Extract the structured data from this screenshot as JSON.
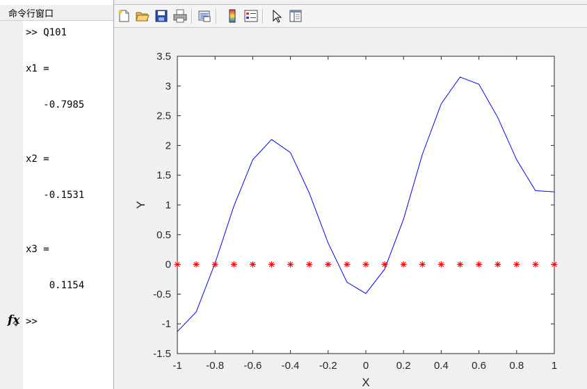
{
  "command_window": {
    "title": "命令行窗口",
    "lines": [
      {
        "text": ">> Q101"
      },
      {
        "text": "x1 ="
      },
      {
        "text": "   -0.7985"
      },
      {
        "text": "x2 ="
      },
      {
        "text": "   -0.1531"
      },
      {
        "text": "x3 ="
      },
      {
        "text": "    0.1154"
      }
    ],
    "prompt": ">>",
    "fx_label": "fx"
  },
  "toolbar": {
    "icons": [
      "new-figure-icon",
      "open-file-icon",
      "save-icon",
      "print-icon",
      "link-plot-icon",
      "insert-colorbar-icon",
      "insert-legend-icon",
      "edit-plot-arrow-icon",
      "property-inspector-icon"
    ]
  },
  "chart_data": {
    "type": "line",
    "title": "",
    "xlabel": "X",
    "ylabel": "Y",
    "xlim": [
      -1,
      1
    ],
    "ylim": [
      -1.5,
      3.5
    ],
    "xticks": [
      "-1",
      "-0.8",
      "-0.6",
      "-0.4",
      "-0.2",
      "0",
      "0.2",
      "0.4",
      "0.6",
      "0.8",
      "1"
    ],
    "yticks": [
      "-1.5",
      "-1",
      "-0.5",
      "0",
      "0.5",
      "1",
      "1.5",
      "2",
      "2.5",
      "3",
      "3.5"
    ],
    "x": [
      -1,
      -0.9,
      -0.8,
      -0.7,
      -0.6,
      -0.5,
      -0.4,
      -0.3,
      -0.2,
      -0.1,
      0,
      0.1,
      0.2,
      0.3,
      0.4,
      0.5,
      0.6,
      0.7,
      0.8,
      0.9,
      1
    ],
    "series": [
      {
        "color": "#0000ff",
        "style": "line",
        "values": [
          -1.13,
          -0.8,
          0.02,
          0.98,
          1.76,
          2.1,
          1.88,
          1.2,
          0.36,
          -0.3,
          -0.49,
          -0.08,
          0.76,
          1.85,
          2.7,
          3.15,
          3.03,
          2.47,
          1.76,
          1.24,
          1.22
        ]
      },
      {
        "color": "#ff0000",
        "style": "marker-star",
        "values": [
          0,
          0,
          0,
          0,
          0,
          0,
          0,
          0,
          0,
          0,
          0,
          0,
          0,
          0,
          0,
          0,
          0,
          0,
          0,
          0,
          0
        ]
      }
    ],
    "grid": false,
    "box": true
  }
}
